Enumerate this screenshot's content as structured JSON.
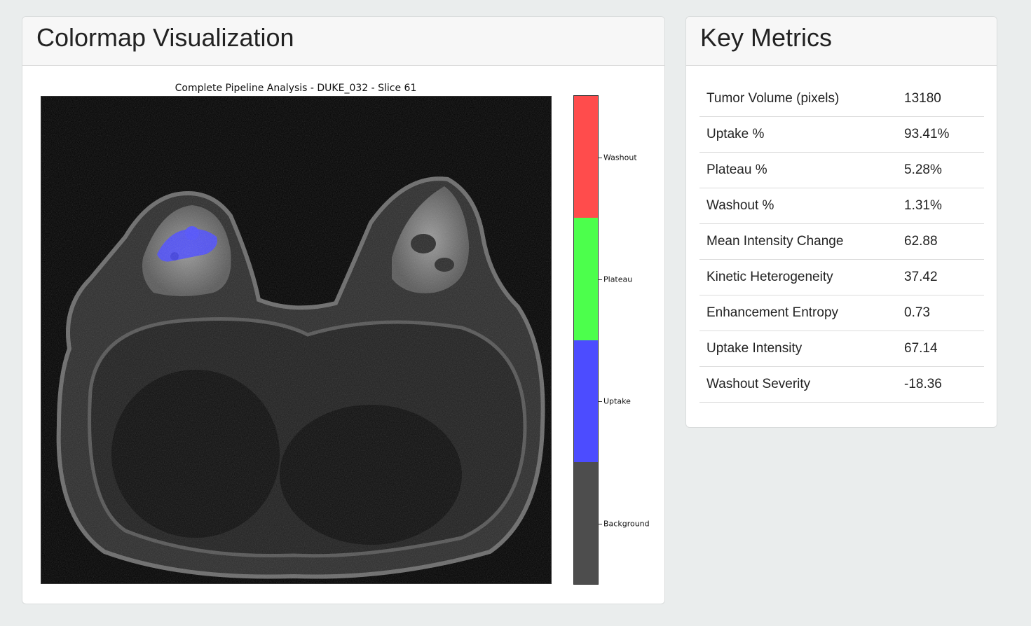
{
  "viz_panel": {
    "title": "Colormap Visualization",
    "figure_title": "Complete Pipeline Analysis - DUKE_032 - Slice 61",
    "colorbar": [
      {
        "label": "Washout",
        "color": "#ff4c4c"
      },
      {
        "label": "Plateau",
        "color": "#4cff4c"
      },
      {
        "label": "Uptake",
        "color": "#4c4cff"
      },
      {
        "label": "Background",
        "color": "#4d4d4d"
      }
    ]
  },
  "metrics_panel": {
    "title": "Key Metrics",
    "rows": [
      {
        "label": "Tumor Volume (pixels)",
        "value": "13180"
      },
      {
        "label": "Uptake %",
        "value": "93.41%"
      },
      {
        "label": "Plateau %",
        "value": "5.28%"
      },
      {
        "label": "Washout %",
        "value": "1.31%"
      },
      {
        "label": "Mean Intensity Change",
        "value": "62.88"
      },
      {
        "label": "Kinetic Heterogeneity",
        "value": "37.42"
      },
      {
        "label": "Enhancement Entropy",
        "value": "0.73"
      },
      {
        "label": "Uptake Intensity",
        "value": "67.14"
      },
      {
        "label": "Washout Severity",
        "value": "-18.36"
      }
    ]
  }
}
